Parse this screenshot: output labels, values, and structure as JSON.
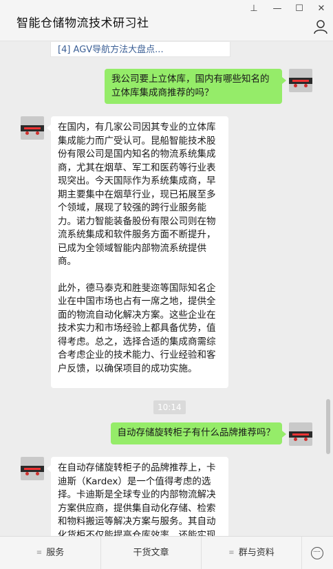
{
  "window": {
    "title": "智能仓储物流技术研习社",
    "controls": {
      "pin": "⊥",
      "minimize": "—",
      "maximize": "☐",
      "close": "✕"
    },
    "person_icon": "person-icon"
  },
  "chat": {
    "previous_reference": "[4] AGV导航方法大盘点...",
    "messages": [
      {
        "sender": "me",
        "text": "我公司要上立体库，国内有哪些知名的\n立体库集成商推荐的吗？"
      },
      {
        "sender": "bot",
        "paragraphs": [
          "在国内，有几家公司因其专业的立体库\n集成能力而广受认可。昆船智能技术股\n份有限公司是国内知名的物流系统集成\n商，尤其在烟草、军工和医药等行业表\n现突出。今天国际作为系统集成商，早\n期主要集中在烟草行业，现已拓展至多\n个领域，展现了较强的跨行业服务能\n力。诺力智能装备股份有限公司则在物\n流系统集成和软件服务方面不断提升，\n已成为全领域智能内部物流系统提供\n商。",
          "此外，德马泰克和胜斐迩等国际知名企\n业在中国市场也占有一席之地，提供全\n面的物流自动化解决方案。这些企业在\n技术实力和市场经验上都具备优势，值\n得考虑。总之，选择合适的集成商需综\n合考虑企业的技术能力、行业经验和客\n户反馈，以确保项目的成功实施。"
        ]
      },
      {
        "sender": "time",
        "text": "10:14"
      },
      {
        "sender": "me",
        "text": "自动存储旋转柜子有什么品牌推荐吗？"
      },
      {
        "sender": "bot",
        "paragraphs": [
          "在自动存储旋转柜子的品牌推荐上，卡\n迪斯（Kardex）是一个值得考虑的选\n择。卡迪斯是全球专业的内部物流解决\n方案供应商，提供集自动化存储、检索\n和物料搬运等解决方案与服务。其自动\n化货柜不仅能提高仓库效率，还能实现"
        ]
      }
    ]
  },
  "bottom_bar": {
    "tabs": [
      "服务",
      "干货文章",
      "群与资料"
    ],
    "menu_icon": "≡",
    "keyboard_icon": "keyboard-toggle-icon"
  }
}
